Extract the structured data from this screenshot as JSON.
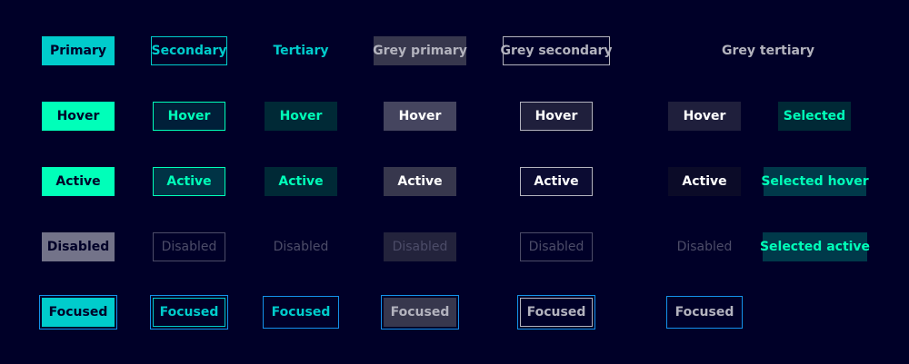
{
  "colors": {
    "background": "#000028",
    "primary": "#00CCCC",
    "primary_hover": "#00FFB9",
    "focus_ring": "#1491EB",
    "disabled": "#737389",
    "grey": "#B3B3BE"
  },
  "primary": {
    "default": "Primary",
    "hover": "Hover",
    "active": "Active",
    "disabled": "Disabled",
    "focused": "Focused"
  },
  "secondary": {
    "default": "Secondary",
    "hover": "Hover",
    "active": "Active",
    "disabled": "Disabled",
    "focused": "Focused"
  },
  "tertiary": {
    "default": "Tertiary",
    "hover": "Hover",
    "active": "Active",
    "disabled": "Disabled",
    "focused": "Focused"
  },
  "grey_primary": {
    "default": "Grey primary",
    "hover": "Hover",
    "active": "Active",
    "disabled": "Disabled",
    "focused": "Focused"
  },
  "grey_secondary": {
    "default": "Grey secondary",
    "hover": "Hover",
    "active": "Active",
    "disabled": "Disabled",
    "focused": "Focused"
  },
  "grey_tertiary": {
    "default": "Grey tertiary",
    "hover": "Hover",
    "active": "Active",
    "disabled": "Disabled",
    "focused": "Focused"
  },
  "selected": {
    "default": "Selected",
    "hover": "Selected hover",
    "active": "Selected active"
  }
}
